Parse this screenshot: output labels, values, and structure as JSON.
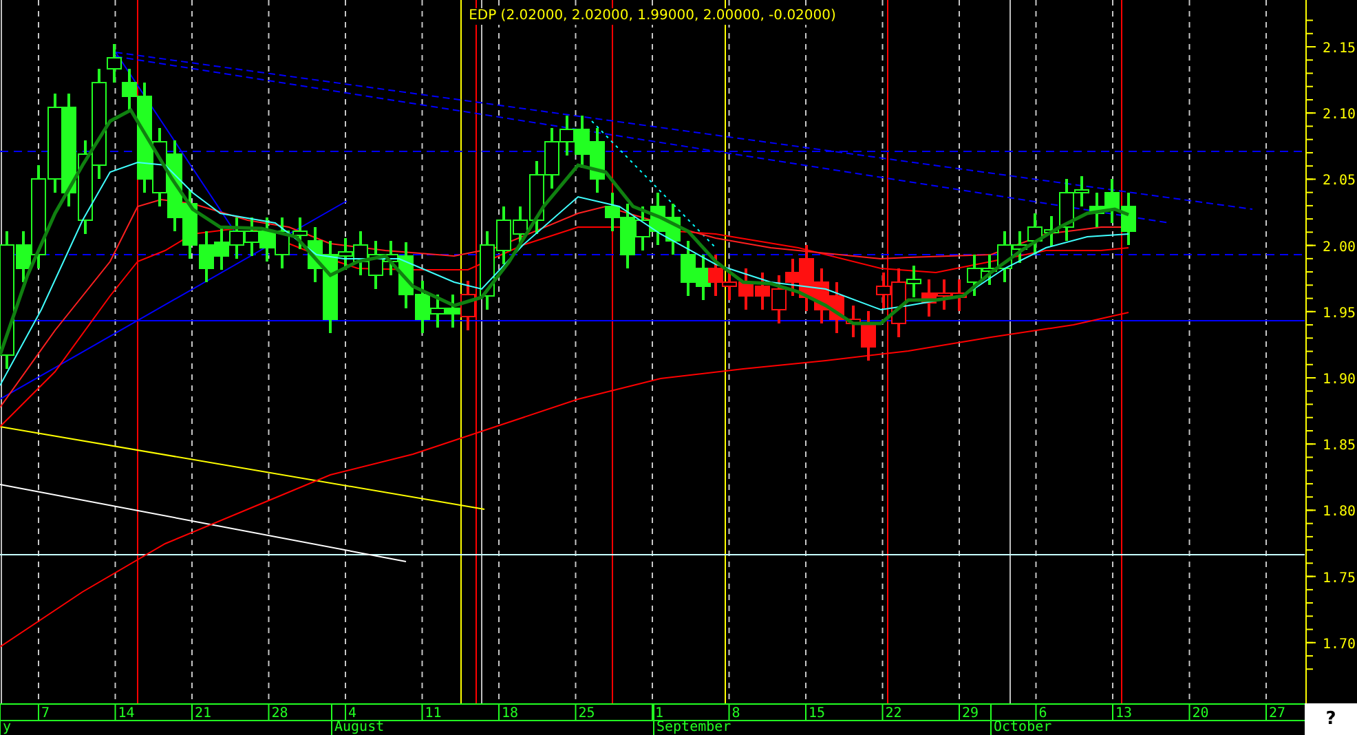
{
  "chart": {
    "title": "EDP (2.02000, 2.02000, 1.99000, 2.00000, -0.02000)"
  },
  "price_axis": {
    "labels": [
      "2.15",
      "2.10",
      "2.05",
      "2.00",
      "1.95",
      "1.90",
      "1.85",
      "1.80",
      "1.75",
      "1.70"
    ]
  },
  "date_axis": {
    "days": [
      "7",
      "14",
      "21",
      "28",
      "4",
      "11",
      "18",
      "25",
      "1",
      "8",
      "15",
      "22",
      "29",
      "6",
      "13",
      "20",
      "27"
    ],
    "months": [
      "y",
      "August",
      "September",
      "October"
    ]
  },
  "help_button": {
    "label": "?"
  }
}
